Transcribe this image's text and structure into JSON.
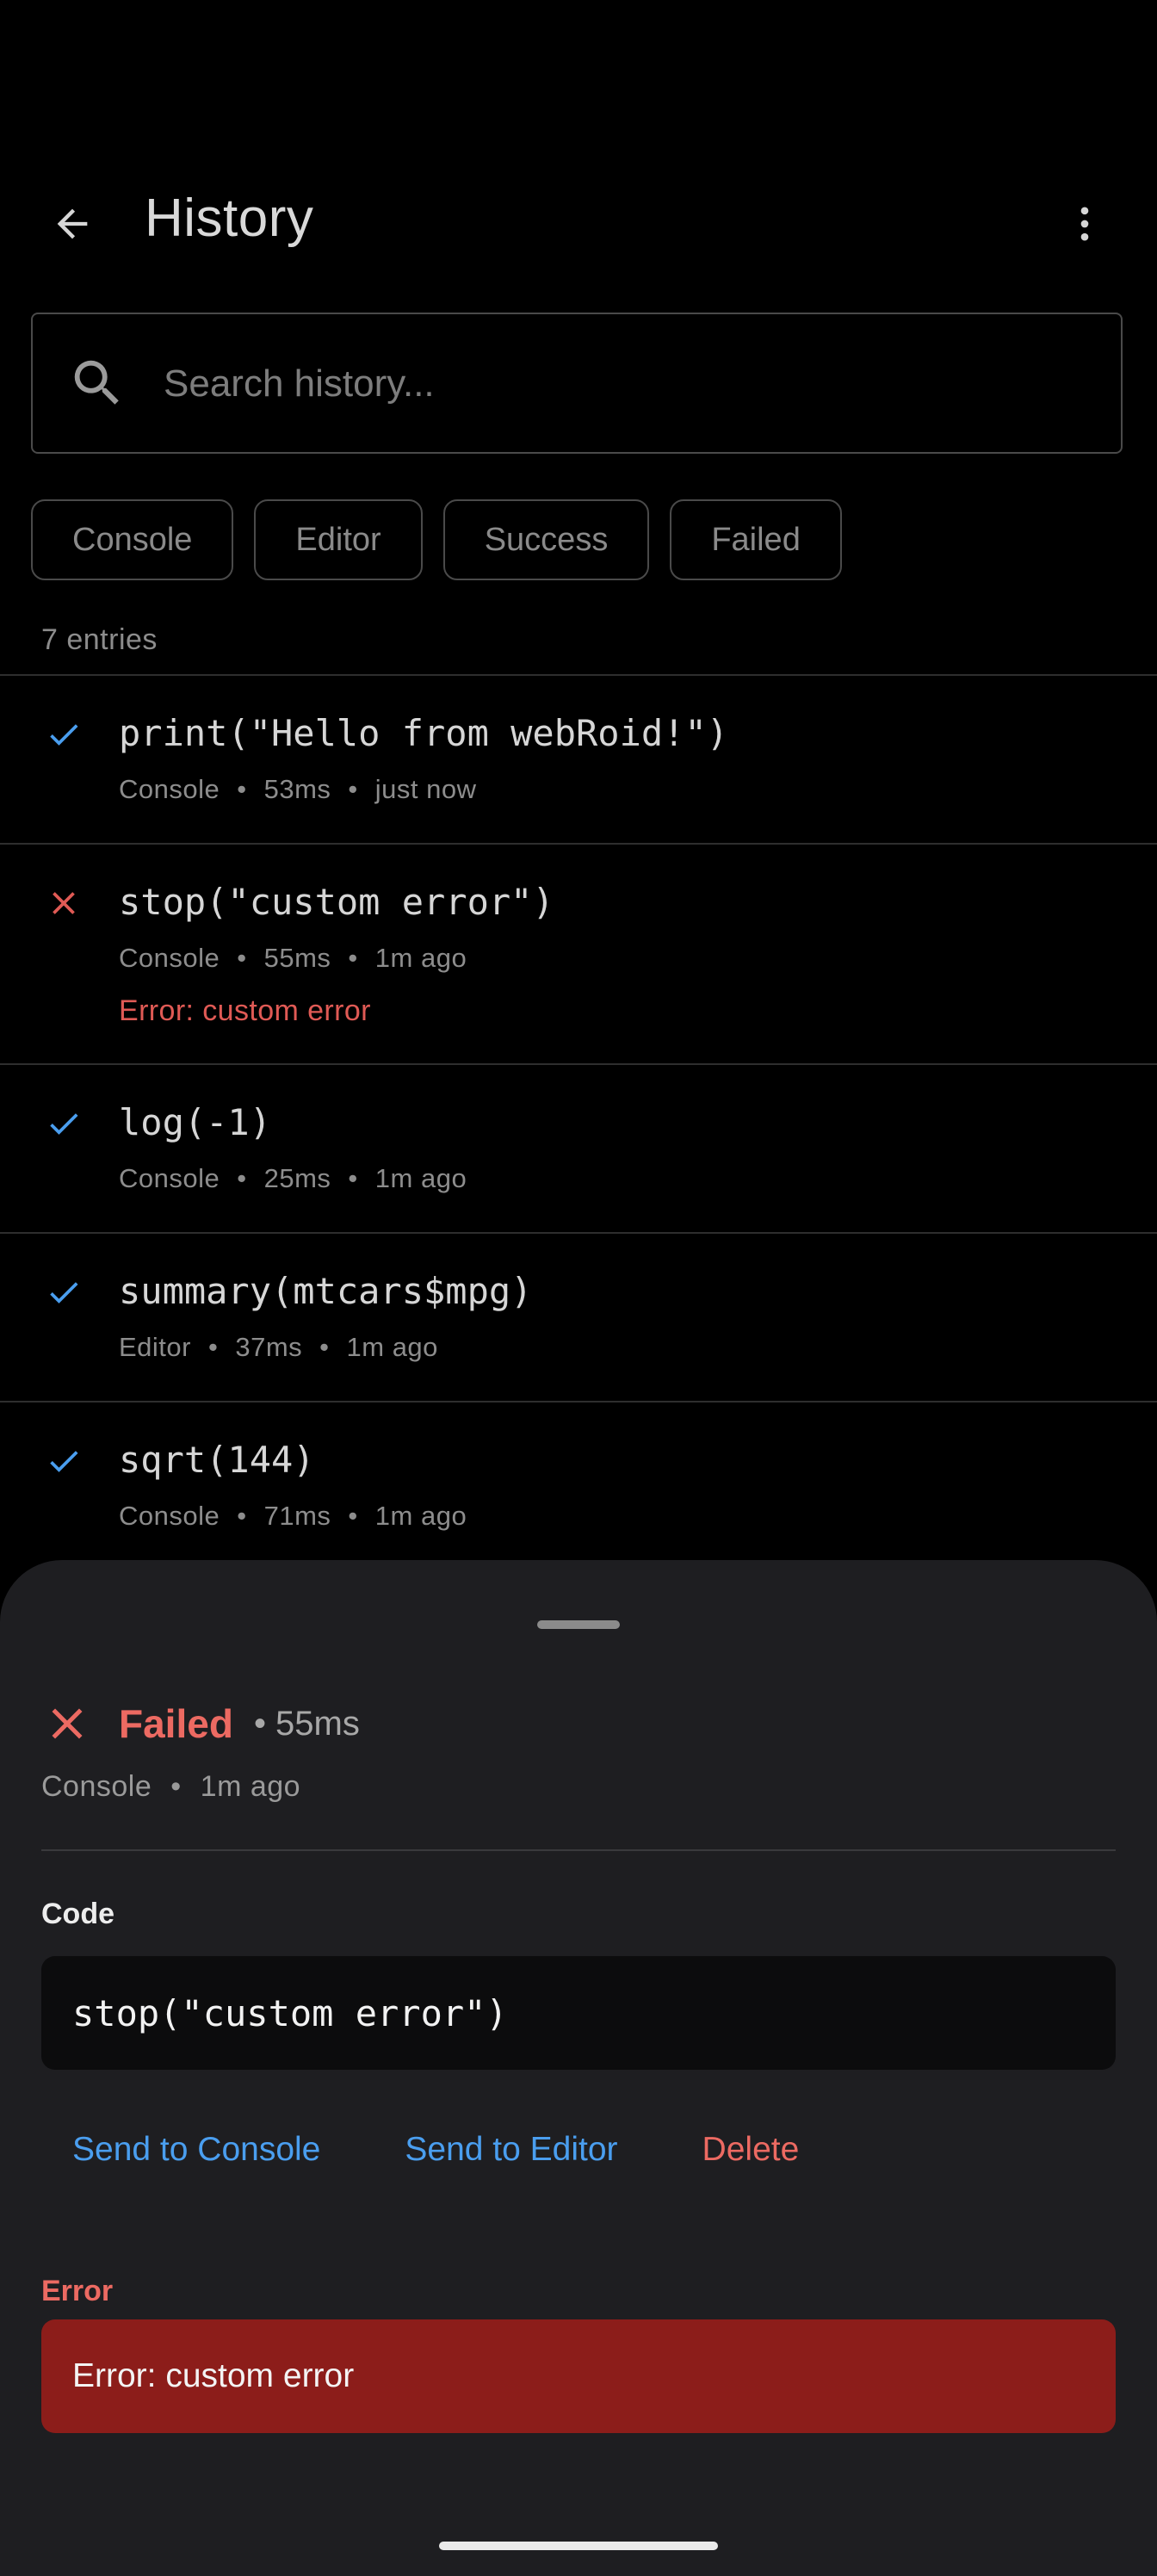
{
  "header": {
    "title": "History",
    "back_icon": "arrow-back-icon",
    "more_icon": "more-vert-icon"
  },
  "search": {
    "placeholder": "Search history...",
    "value": ""
  },
  "filters": [
    "Console",
    "Editor",
    "Success",
    "Failed"
  ],
  "entries_count": "7 entries",
  "entries": [
    {
      "code": "print(\"Hello from webRoid!\")",
      "source": "Console",
      "duration": "53ms",
      "time": "just now",
      "status": "success"
    },
    {
      "code": "stop(\"custom error\")",
      "source": "Console",
      "duration": "55ms",
      "time": "1m ago",
      "status": "failed",
      "error": "Error: custom error"
    },
    {
      "code": "log(-1)",
      "source": "Console",
      "duration": "25ms",
      "time": "1m ago",
      "status": "success"
    },
    {
      "code": "summary(mtcars$mpg)",
      "source": "Editor",
      "duration": "37ms",
      "time": "1m ago",
      "status": "success"
    },
    {
      "code": "sqrt(144)",
      "source": "Console",
      "duration": "71ms",
      "time": "1m ago",
      "status": "success"
    }
  ],
  "sheet": {
    "status": "Failed",
    "duration": "• 55ms",
    "source": "Console",
    "time": "1m ago",
    "code_heading": "Code",
    "code": "stop(\"custom error\")",
    "actions": {
      "send_console": "Send to Console",
      "send_editor": "Send to Editor",
      "delete": "Delete"
    },
    "error_heading": "Error",
    "error": "Error: custom error"
  },
  "colors": {
    "success": "#4a9eef",
    "failed": "#e05a55",
    "error_box": "#8c1d1a",
    "sheet_bg": "#1e1e21"
  }
}
